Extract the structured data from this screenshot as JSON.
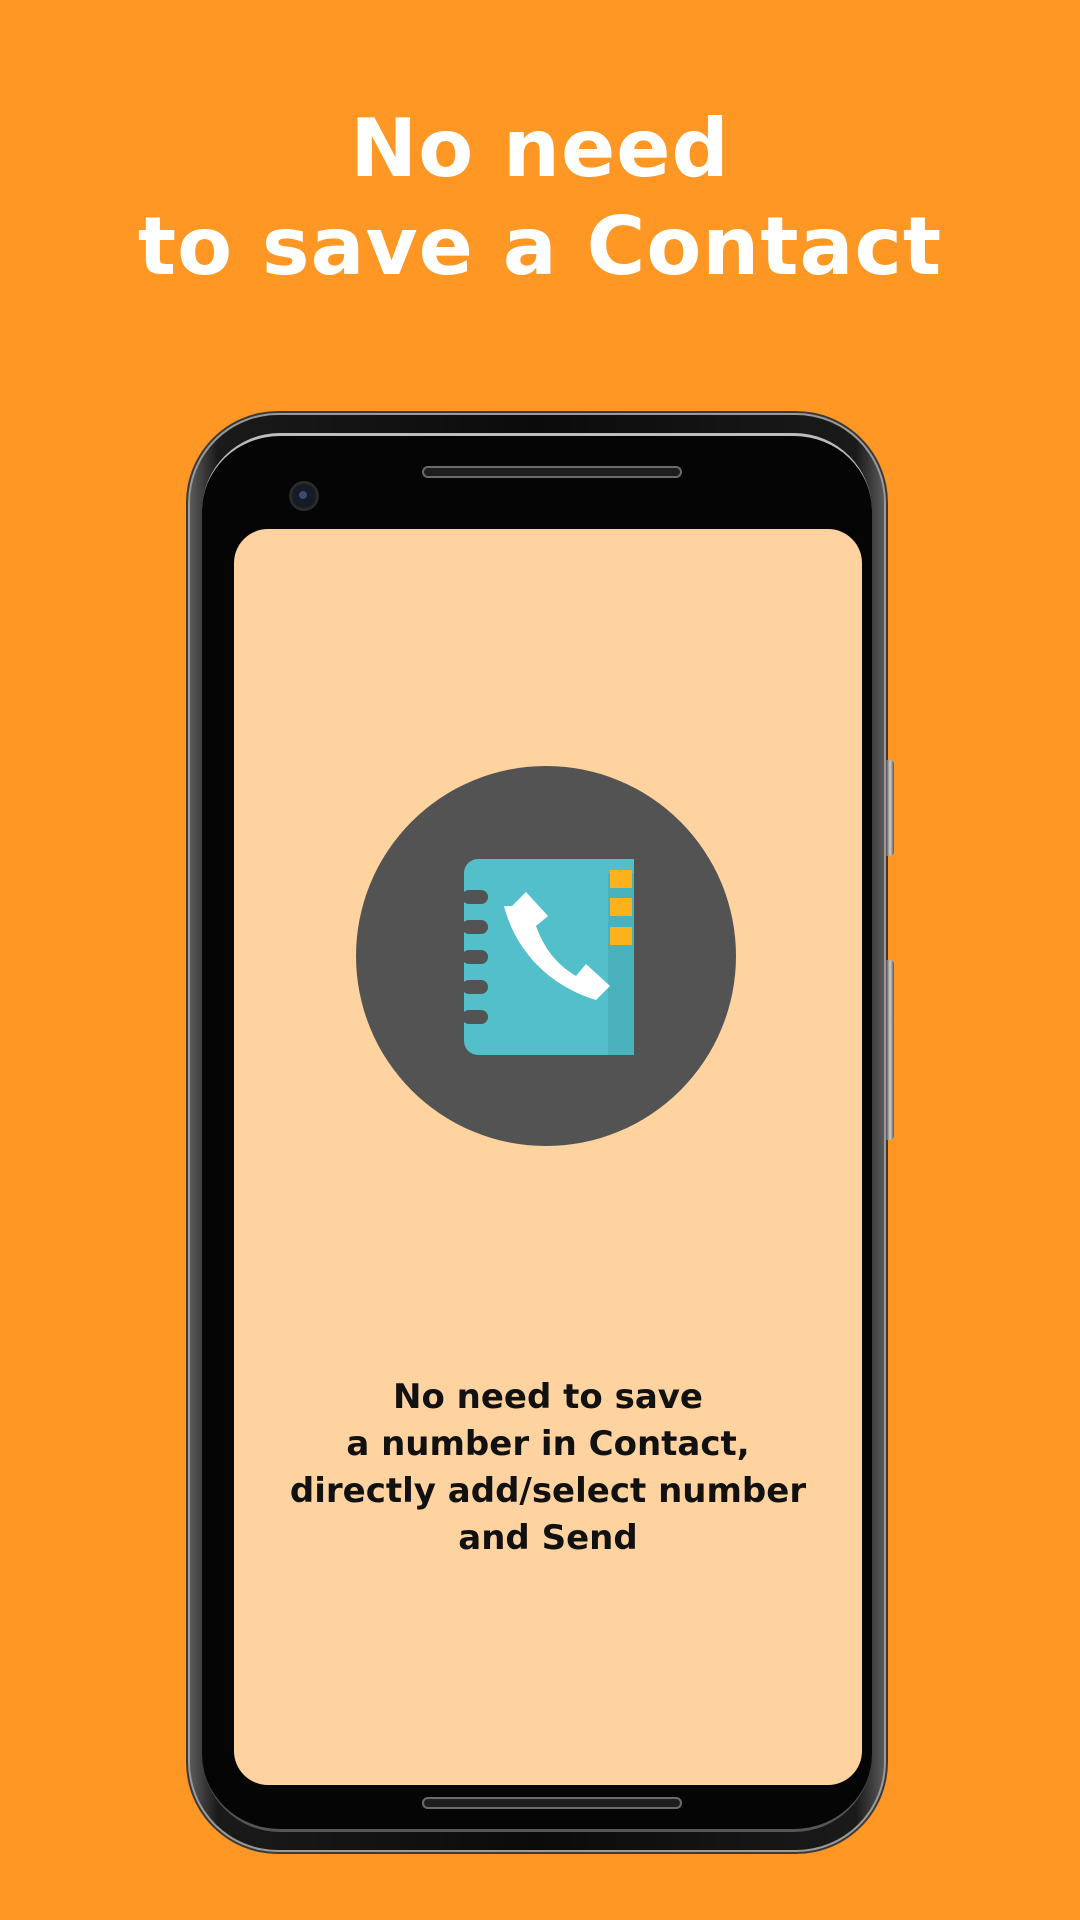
{
  "headline": {
    "line1": "No need",
    "line2": "to save a Contact"
  },
  "screen": {
    "icon": "contact-book-phone-icon",
    "description": [
      "No need to save",
      "a number in Contact,",
      "directly add/select number",
      "and Send"
    ]
  },
  "colors": {
    "background": "#FF9724",
    "screen": "#FED3A0",
    "circle": "#535353",
    "book": "#52BFCA",
    "tabs": "#FDB11A"
  }
}
